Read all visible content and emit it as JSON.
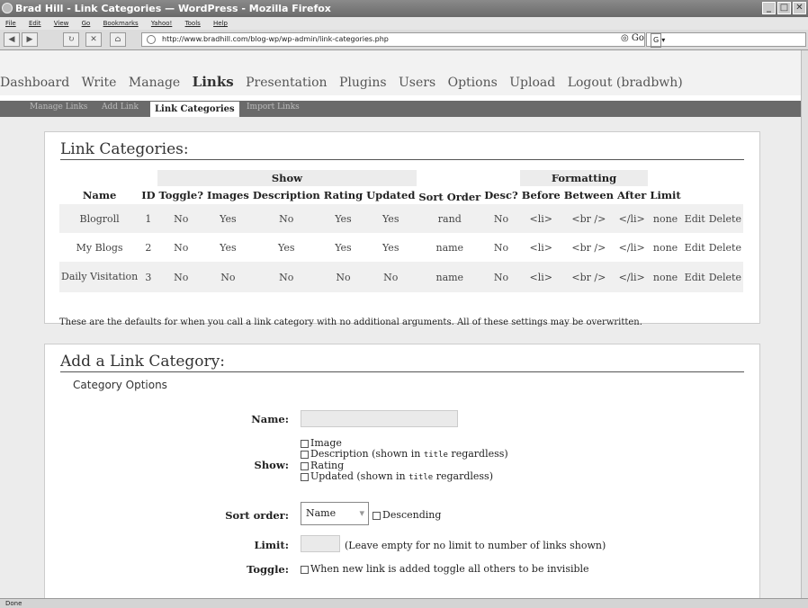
{
  "window": {
    "title": "Brad Hill - Link Categories — WordPress - Mozilla Firefox"
  },
  "menubar": [
    "File",
    "Edit",
    "View",
    "Go",
    "Bookmarks",
    "Yahoo!",
    "Tools",
    "Help"
  ],
  "navbar": {
    "url": "http://www.bradhill.com/blog-wp/wp-admin/link-categories.php",
    "go_label": "Go",
    "search_engine": "G"
  },
  "admin_menu": [
    "Dashboard",
    "Write",
    "Manage",
    "Links",
    "Presentation",
    "Plugins",
    "Users",
    "Options",
    "Upload",
    "Logout (bradbwh)"
  ],
  "sub_menu": [
    "Manage Links",
    "Add Link",
    "Link Categories",
    "Import Links"
  ],
  "categories": {
    "heading": "Link Categories:",
    "group_show": "Show",
    "group_formatting": "Formatting",
    "columns": [
      "Name",
      "ID",
      "Toggle?",
      "Images",
      "Description",
      "Rating",
      "Updated",
      "Sort Order",
      "Desc?",
      "Before",
      "Between",
      "After",
      "Limit"
    ],
    "rows": [
      {
        "name": "Blogroll",
        "id": "1",
        "toggle": "No",
        "images": "Yes",
        "description": "No",
        "rating": "Yes",
        "updated": "Yes",
        "sort": "rand",
        "desc": "No",
        "before": "<li>",
        "between": "<br />",
        "after": "</li>",
        "limit": "none",
        "edit": "Edit",
        "delete": "Delete"
      },
      {
        "name": "My Blogs",
        "id": "2",
        "toggle": "No",
        "images": "Yes",
        "description": "Yes",
        "rating": "Yes",
        "updated": "Yes",
        "sort": "name",
        "desc": "No",
        "before": "<li>",
        "between": "<br />",
        "after": "</li>",
        "limit": "none",
        "edit": "Edit",
        "delete": "Delete"
      },
      {
        "name": "Daily Visitation",
        "id": "3",
        "toggle": "No",
        "images": "No",
        "description": "No",
        "rating": "No",
        "updated": "No",
        "sort": "name",
        "desc": "No",
        "before": "<li>",
        "between": "<br />",
        "after": "</li>",
        "limit": "none",
        "edit": "Edit",
        "delete": "Delete"
      }
    ],
    "note": "These are the defaults for when you call a link category with no additional arguments. All of these settings may be overwritten."
  },
  "add": {
    "heading": "Add a Link Category:",
    "legend": "Category Options",
    "name_label": "Name:",
    "show_label": "Show:",
    "show_image": "Image",
    "show_desc_pre": "Description (shown in ",
    "show_desc_code": "title",
    "show_desc_post": " regardless)",
    "show_rating": "Rating",
    "show_updated_pre": "Updated (shown in ",
    "show_updated_code": "title",
    "show_updated_post": " regardless)",
    "sort_label": "Sort order:",
    "sort_value": "Name",
    "descending": "Descending",
    "limit_label": "Limit:",
    "limit_hint": "(Leave empty for no limit to number of links shown)",
    "toggle_label": "Toggle:",
    "toggle_text": "When new link is added toggle all others to be invisible"
  },
  "status": "Done"
}
